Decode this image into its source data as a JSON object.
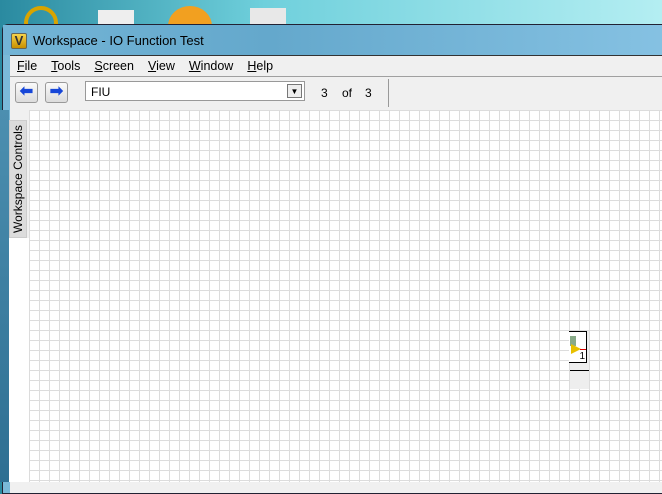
{
  "window": {
    "title": "Workspace - IO Function Test",
    "app_icon_letter": "V"
  },
  "menu": [
    {
      "label": "File",
      "key": "F",
      "rest": "ile"
    },
    {
      "label": "Tools",
      "key": "T",
      "rest": "ools"
    },
    {
      "label": "Screen",
      "key": "S",
      "rest": "creen"
    },
    {
      "label": "View",
      "key": "V",
      "rest": "iew"
    },
    {
      "label": "Window",
      "key": "W",
      "rest": "indow"
    },
    {
      "label": "Help",
      "key": "H",
      "rest": "elp"
    }
  ],
  "toolbar": {
    "back_icon": "arrow-left",
    "forward_icon": "arrow-right",
    "screen_select": "FIU",
    "current": "3",
    "of_label": "of",
    "total": "3"
  },
  "sidebar": {
    "tab_label": "Workspace Controls"
  },
  "node": {
    "label": "1"
  },
  "colors": {
    "accent": "#1646d8",
    "titlebar": "#73b4d6"
  }
}
